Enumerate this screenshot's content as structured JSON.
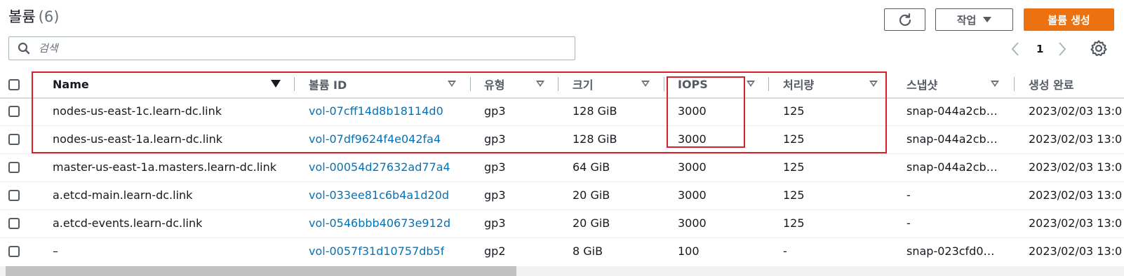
{
  "header": {
    "title": "볼륨",
    "count": "(6)",
    "actions_label": "작업",
    "create_label": "볼륨 생성"
  },
  "search": {
    "placeholder": "검색"
  },
  "pagination": {
    "current_page": "1"
  },
  "columns": [
    "Name",
    "볼륨 ID",
    "유형",
    "크기",
    "IOPS",
    "처리량",
    "스냅샷",
    "생성 완료"
  ],
  "rows": [
    [
      "nodes-us-east-1c.learn-dc.link",
      "vol-07cff14d8b18114d0",
      "gp3",
      "128 GiB",
      "3000",
      "125",
      "snap-044a2cb…",
      "2023/02/03 13:0"
    ],
    [
      "nodes-us-east-1a.learn-dc.link",
      "vol-07df9624f4e042fa4",
      "gp3",
      "128 GiB",
      "3000",
      "125",
      "snap-044a2cb…",
      "2023/02/03 13:0"
    ],
    [
      "master-us-east-1a.masters.learn-dc.link",
      "vol-00054d27632ad77a4",
      "gp3",
      "64 GiB",
      "3000",
      "125",
      "snap-044a2cb…",
      "2023/02/03 13:0"
    ],
    [
      "a.etcd-main.learn-dc.link",
      "vol-033ee81c6b4a1d20d",
      "gp3",
      "20 GiB",
      "3000",
      "125",
      "-",
      "2023/02/03 13:0"
    ],
    [
      "a.etcd-events.learn-dc.link",
      "vol-0546bbb40673e912d",
      "gp3",
      "20 GiB",
      "3000",
      "125",
      "-",
      "2023/02/03 13:0"
    ],
    [
      "–",
      "vol-0057f31d10757db5f",
      "gp2",
      "8 GiB",
      "100",
      "-",
      "snap-023cfd0…",
      "2023/02/03 13:0"
    ]
  ],
  "colors": {
    "primary": "#ec7211",
    "link": "#0073bb",
    "highlight": "#d9202a",
    "text": "#16191f",
    "muted": "#545b64"
  },
  "icons": {
    "refresh": "refresh-icon",
    "search": "search-icon",
    "prev": "chevron-left-icon",
    "next": "chevron-right-icon",
    "settings": "gear-icon"
  }
}
